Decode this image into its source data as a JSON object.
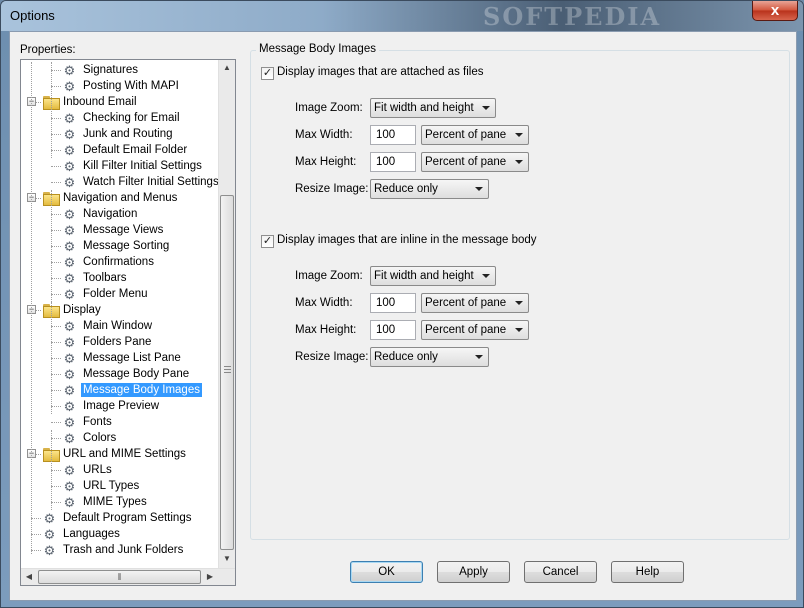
{
  "window": {
    "title": "Options",
    "watermark": "SOFTPEDIA",
    "close_label": "x"
  },
  "colors": {
    "selection": "#3399ff",
    "titlebar": "#8eabc8",
    "dialog_bg": "#f0f0f0"
  },
  "tree": {
    "label": "Properties:",
    "items": [
      {
        "label": "Signatures",
        "icon": "gear-icon"
      },
      {
        "label": "Posting With MAPI",
        "icon": "gear-icon"
      },
      {
        "label": "Inbound Email",
        "icon": "folder-icon"
      },
      {
        "label": "Checking for Email",
        "icon": "gear-icon"
      },
      {
        "label": "Junk and Routing",
        "icon": "gear-icon"
      },
      {
        "label": "Default Email Folder",
        "icon": "gear-icon"
      },
      {
        "label": "Kill Filter Initial Settings",
        "icon": "gear-icon"
      },
      {
        "label": "Watch Filter Initial Settings",
        "icon": "gear-icon"
      },
      {
        "label": "Navigation and Menus",
        "icon": "folder-icon"
      },
      {
        "label": "Navigation",
        "icon": "gear-icon"
      },
      {
        "label": "Message Views",
        "icon": "gear-icon"
      },
      {
        "label": "Message Sorting",
        "icon": "gear-icon"
      },
      {
        "label": "Confirmations",
        "icon": "gear-icon"
      },
      {
        "label": "Toolbars",
        "icon": "gear-icon"
      },
      {
        "label": "Folder Menu",
        "icon": "gear-icon"
      },
      {
        "label": "Display",
        "icon": "folder-icon"
      },
      {
        "label": "Main Window",
        "icon": "gear-icon"
      },
      {
        "label": "Folders Pane",
        "icon": "gear-icon"
      },
      {
        "label": "Message List Pane",
        "icon": "gear-icon"
      },
      {
        "label": "Message Body Pane",
        "icon": "gear-icon"
      },
      {
        "label": "Message Body Images",
        "icon": "gear-icon",
        "selected": true
      },
      {
        "label": "Image Preview",
        "icon": "gear-icon"
      },
      {
        "label": "Fonts",
        "icon": "gear-icon"
      },
      {
        "label": "Colors",
        "icon": "gear-icon"
      },
      {
        "label": "URL and MIME Settings",
        "icon": "folder-icon"
      },
      {
        "label": "URLs",
        "icon": "gear-icon"
      },
      {
        "label": "URL Types",
        "icon": "gear-icon"
      },
      {
        "label": "MIME Types",
        "icon": "gear-icon"
      },
      {
        "label": "Default Program Settings",
        "icon": "gear-icon"
      },
      {
        "label": "Languages",
        "icon": "gear-icon"
      },
      {
        "label": "Trash and Junk Folders",
        "icon": "gear-icon"
      }
    ]
  },
  "panel": {
    "group_title": "Message Body Images",
    "attached": {
      "checkbox_label": "Display images that are attached as files",
      "checked": true,
      "image_zoom_label": "Image Zoom:",
      "image_zoom_value": "Fit width and height",
      "max_width_label": "Max Width:",
      "max_width_value": "100",
      "max_width_unit": "Percent of pane",
      "max_height_label": "Max Height:",
      "max_height_value": "100",
      "max_height_unit": "Percent of pane",
      "resize_label": "Resize Image:",
      "resize_value": "Reduce only"
    },
    "inline": {
      "checkbox_label": "Display images that are inline in the message body",
      "checked": true,
      "image_zoom_label": "Image Zoom:",
      "image_zoom_value": "Fit width and height",
      "max_width_label": "Max Width:",
      "max_width_value": "100",
      "max_width_unit": "Percent of pane",
      "max_height_label": "Max Height:",
      "max_height_value": "100",
      "max_height_unit": "Percent of pane",
      "resize_label": "Resize Image:",
      "resize_value": "Reduce only"
    }
  },
  "buttons": {
    "ok": "OK",
    "apply": "Apply",
    "cancel": "Cancel",
    "help": "Help"
  }
}
